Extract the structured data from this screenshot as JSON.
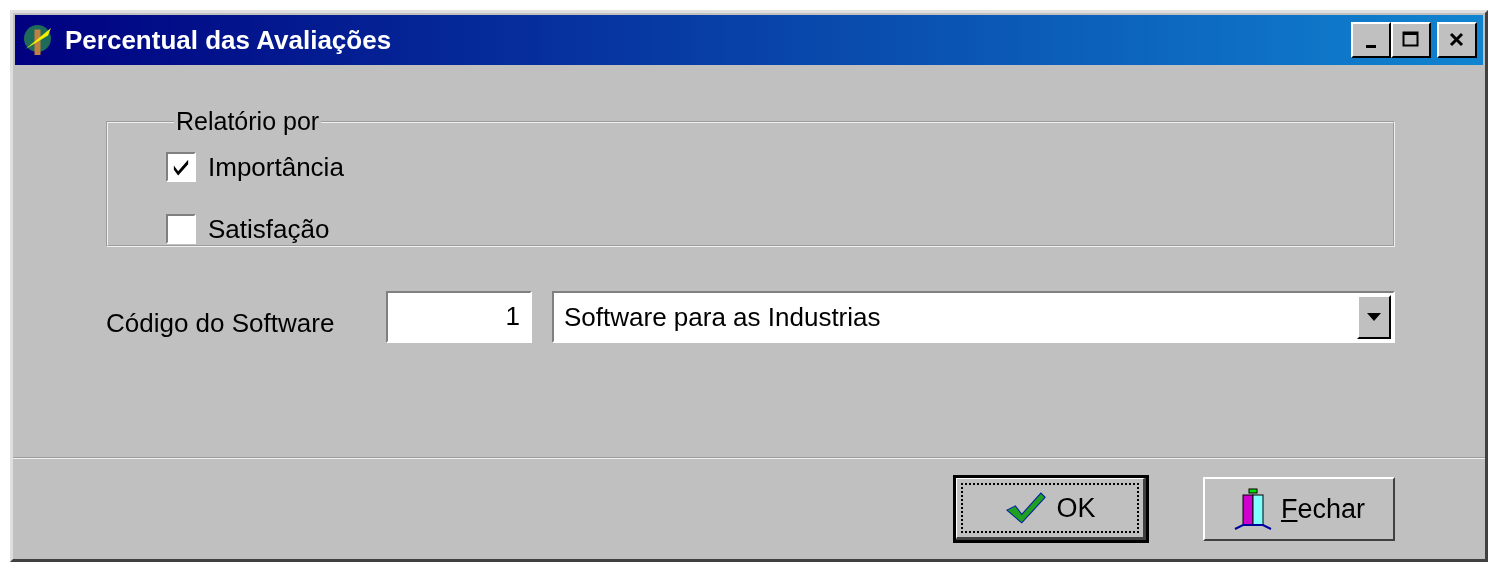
{
  "window": {
    "title": "Percentual das Avaliações",
    "controls": [
      {
        "kind": "minimize"
      },
      {
        "kind": "maximize"
      },
      {
        "kind": "close"
      }
    ]
  },
  "report_group": {
    "legend": "Relatório por",
    "options": [
      {
        "label": "Importância",
        "checked": true
      },
      {
        "label": "Satisfação",
        "checked": false
      }
    ]
  },
  "software": {
    "label": "Código do Software",
    "code": "1",
    "selection": "Software para as Industrias"
  },
  "buttons": [
    {
      "kind": "ok",
      "label": "OK",
      "default": true,
      "underline_first": false
    },
    {
      "kind": "close",
      "label": "Fechar",
      "default": false,
      "underline_first": true
    }
  ]
}
